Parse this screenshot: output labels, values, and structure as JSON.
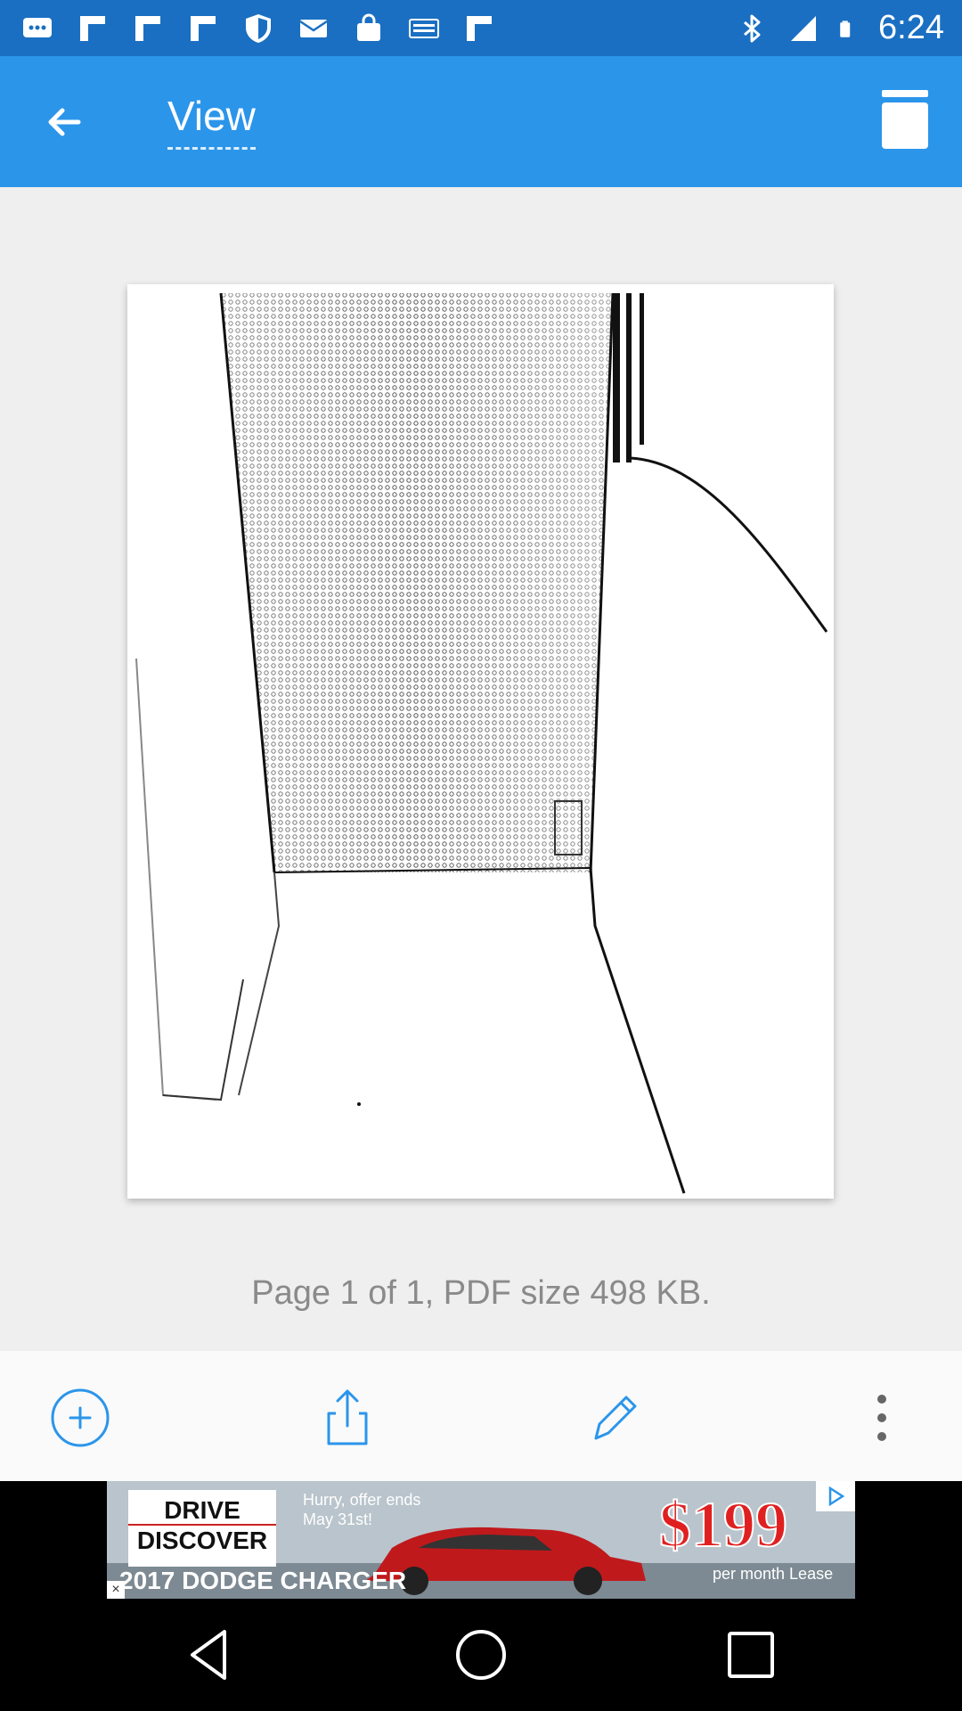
{
  "status_bar": {
    "time": "6:24",
    "icons": [
      "messages-icon",
      "flipboard-icon",
      "flipboard-icon",
      "flipboard-icon",
      "shield-icon",
      "email-icon",
      "shopping-bag-icon",
      "espn-icon",
      "flipboard-icon",
      "bluetooth-icon",
      "signal-icon",
      "battery-icon"
    ]
  },
  "app_bar": {
    "title": "View",
    "back_icon": "arrow-left-icon",
    "menu_icon": "pages-icon"
  },
  "content": {
    "page_info": "Page 1 of 1, PDF size 498 KB."
  },
  "toolbar": {
    "buttons": [
      "add-icon",
      "share-icon",
      "edit-icon",
      "more-vert-icon"
    ]
  },
  "ad": {
    "logo_line1": "DRIVE",
    "logo_line2": "DISCOVER",
    "offer_line1": "Hurry, offer ends",
    "offer_line2": "May 31st!",
    "model": "2017 DODGE CHARGER",
    "price": "$199",
    "lease": "per month Lease",
    "close": "×"
  },
  "colors": {
    "status_bar": "#1a6fc2",
    "app_bar": "#2b95ea",
    "accent": "#2b95ea",
    "content_bg": "#efefef"
  }
}
